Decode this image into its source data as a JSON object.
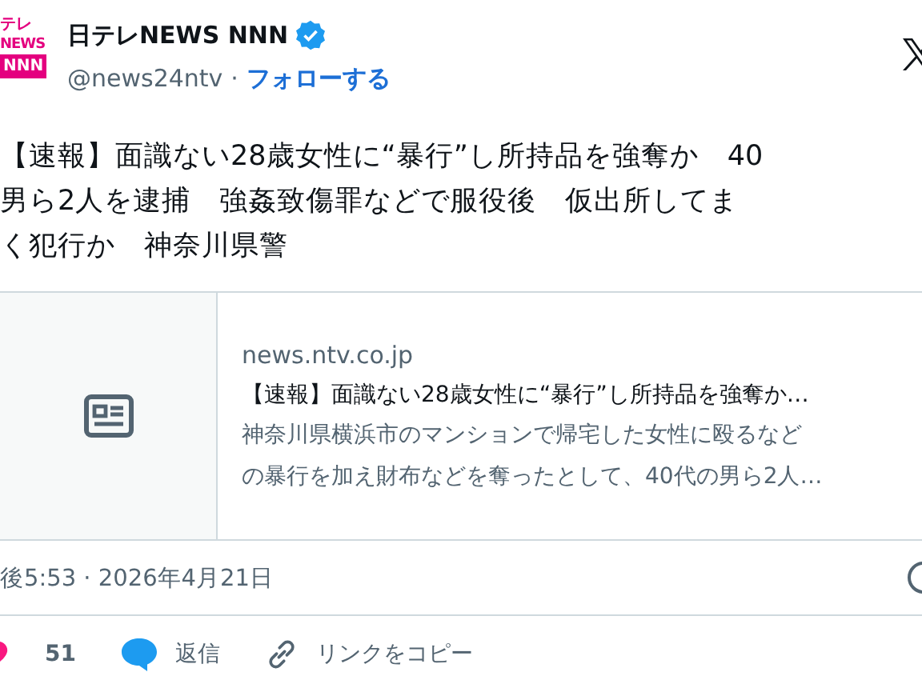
{
  "author": {
    "logo_lines": [
      "テレ",
      "NEWS",
      "NNN"
    ],
    "name": "日テレNEWS NNN",
    "verified": true,
    "handle": "@news24ntv",
    "separator": "·",
    "follow": "フォローする"
  },
  "text_lines": [
    "【速報】面識ない28歳女性に“暴行”し所持品を強奪か　40",
    "男ら2人を逮捕　強姦致傷罪などで服役後　仮出所してま",
    "く犯行か　神奈川県警"
  ],
  "card": {
    "domain": "news.ntv.co.jp",
    "title": "【速報】面識ない28歳女性に“暴行”し所持品を強奪か…",
    "description": [
      "神奈川県横浜市のマンションで帰宅した女性に殴るなど",
      "の暴行を加え財布などを奪ったとして、40代の男ら2人…"
    ]
  },
  "timestamp": "後5:53 · 2026年4月21日",
  "actions": [
    {
      "kind": "like",
      "label": "51"
    },
    {
      "kind": "reply",
      "label": "返信"
    },
    {
      "kind": "copy",
      "label": "リンクをコピー"
    }
  ]
}
